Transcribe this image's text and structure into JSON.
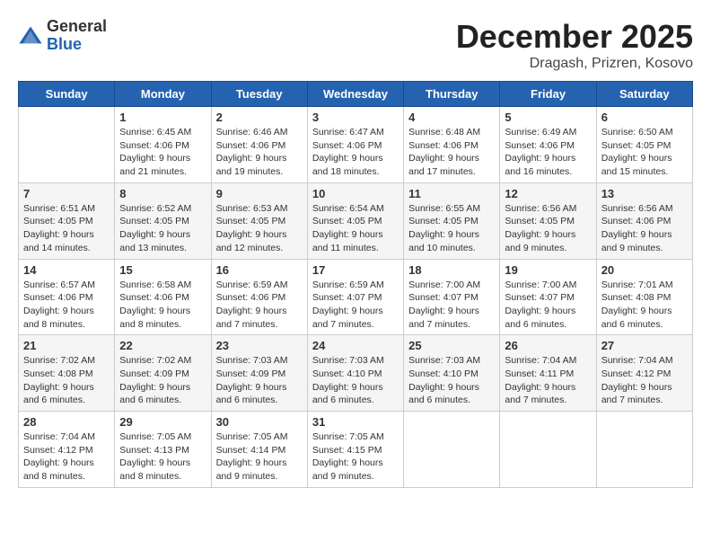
{
  "header": {
    "logo_general": "General",
    "logo_blue": "Blue",
    "month_title": "December 2025",
    "location": "Dragash, Prizren, Kosovo"
  },
  "days_of_week": [
    "Sunday",
    "Monday",
    "Tuesday",
    "Wednesday",
    "Thursday",
    "Friday",
    "Saturday"
  ],
  "weeks": [
    [
      {
        "day": "",
        "info": ""
      },
      {
        "day": "1",
        "info": "Sunrise: 6:45 AM\nSunset: 4:06 PM\nDaylight: 9 hours\nand 21 minutes."
      },
      {
        "day": "2",
        "info": "Sunrise: 6:46 AM\nSunset: 4:06 PM\nDaylight: 9 hours\nand 19 minutes."
      },
      {
        "day": "3",
        "info": "Sunrise: 6:47 AM\nSunset: 4:06 PM\nDaylight: 9 hours\nand 18 minutes."
      },
      {
        "day": "4",
        "info": "Sunrise: 6:48 AM\nSunset: 4:06 PM\nDaylight: 9 hours\nand 17 minutes."
      },
      {
        "day": "5",
        "info": "Sunrise: 6:49 AM\nSunset: 4:06 PM\nDaylight: 9 hours\nand 16 minutes."
      },
      {
        "day": "6",
        "info": "Sunrise: 6:50 AM\nSunset: 4:05 PM\nDaylight: 9 hours\nand 15 minutes."
      }
    ],
    [
      {
        "day": "7",
        "info": "Sunrise: 6:51 AM\nSunset: 4:05 PM\nDaylight: 9 hours\nand 14 minutes."
      },
      {
        "day": "8",
        "info": "Sunrise: 6:52 AM\nSunset: 4:05 PM\nDaylight: 9 hours\nand 13 minutes."
      },
      {
        "day": "9",
        "info": "Sunrise: 6:53 AM\nSunset: 4:05 PM\nDaylight: 9 hours\nand 12 minutes."
      },
      {
        "day": "10",
        "info": "Sunrise: 6:54 AM\nSunset: 4:05 PM\nDaylight: 9 hours\nand 11 minutes."
      },
      {
        "day": "11",
        "info": "Sunrise: 6:55 AM\nSunset: 4:05 PM\nDaylight: 9 hours\nand 10 minutes."
      },
      {
        "day": "12",
        "info": "Sunrise: 6:56 AM\nSunset: 4:05 PM\nDaylight: 9 hours\nand 9 minutes."
      },
      {
        "day": "13",
        "info": "Sunrise: 6:56 AM\nSunset: 4:06 PM\nDaylight: 9 hours\nand 9 minutes."
      }
    ],
    [
      {
        "day": "14",
        "info": "Sunrise: 6:57 AM\nSunset: 4:06 PM\nDaylight: 9 hours\nand 8 minutes."
      },
      {
        "day": "15",
        "info": "Sunrise: 6:58 AM\nSunset: 4:06 PM\nDaylight: 9 hours\nand 8 minutes."
      },
      {
        "day": "16",
        "info": "Sunrise: 6:59 AM\nSunset: 4:06 PM\nDaylight: 9 hours\nand 7 minutes."
      },
      {
        "day": "17",
        "info": "Sunrise: 6:59 AM\nSunset: 4:07 PM\nDaylight: 9 hours\nand 7 minutes."
      },
      {
        "day": "18",
        "info": "Sunrise: 7:00 AM\nSunset: 4:07 PM\nDaylight: 9 hours\nand 7 minutes."
      },
      {
        "day": "19",
        "info": "Sunrise: 7:00 AM\nSunset: 4:07 PM\nDaylight: 9 hours\nand 6 minutes."
      },
      {
        "day": "20",
        "info": "Sunrise: 7:01 AM\nSunset: 4:08 PM\nDaylight: 9 hours\nand 6 minutes."
      }
    ],
    [
      {
        "day": "21",
        "info": "Sunrise: 7:02 AM\nSunset: 4:08 PM\nDaylight: 9 hours\nand 6 minutes."
      },
      {
        "day": "22",
        "info": "Sunrise: 7:02 AM\nSunset: 4:09 PM\nDaylight: 9 hours\nand 6 minutes."
      },
      {
        "day": "23",
        "info": "Sunrise: 7:03 AM\nSunset: 4:09 PM\nDaylight: 9 hours\nand 6 minutes."
      },
      {
        "day": "24",
        "info": "Sunrise: 7:03 AM\nSunset: 4:10 PM\nDaylight: 9 hours\nand 6 minutes."
      },
      {
        "day": "25",
        "info": "Sunrise: 7:03 AM\nSunset: 4:10 PM\nDaylight: 9 hours\nand 6 minutes."
      },
      {
        "day": "26",
        "info": "Sunrise: 7:04 AM\nSunset: 4:11 PM\nDaylight: 9 hours\nand 7 minutes."
      },
      {
        "day": "27",
        "info": "Sunrise: 7:04 AM\nSunset: 4:12 PM\nDaylight: 9 hours\nand 7 minutes."
      }
    ],
    [
      {
        "day": "28",
        "info": "Sunrise: 7:04 AM\nSunset: 4:12 PM\nDaylight: 9 hours\nand 8 minutes."
      },
      {
        "day": "29",
        "info": "Sunrise: 7:05 AM\nSunset: 4:13 PM\nDaylight: 9 hours\nand 8 minutes."
      },
      {
        "day": "30",
        "info": "Sunrise: 7:05 AM\nSunset: 4:14 PM\nDaylight: 9 hours\nand 9 minutes."
      },
      {
        "day": "31",
        "info": "Sunrise: 7:05 AM\nSunset: 4:15 PM\nDaylight: 9 hours\nand 9 minutes."
      },
      {
        "day": "",
        "info": ""
      },
      {
        "day": "",
        "info": ""
      },
      {
        "day": "",
        "info": ""
      }
    ]
  ]
}
